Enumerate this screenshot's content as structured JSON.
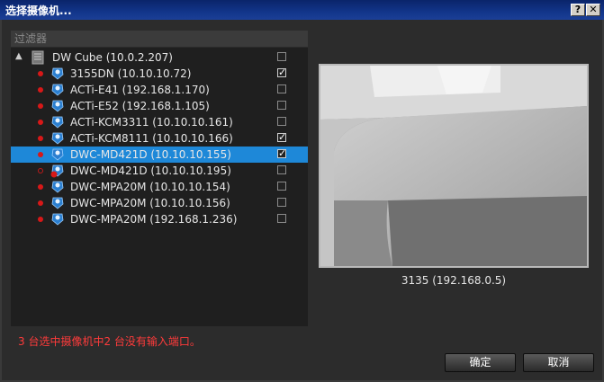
{
  "window": {
    "title": "选择摄像机...",
    "help_glyph": "?",
    "close_glyph": "✕"
  },
  "filter": {
    "placeholder": "过滤器"
  },
  "tree": {
    "server": {
      "label": "DW Cube (10.0.2.207)",
      "checked": false
    },
    "cameras": [
      {
        "label": "3155DN (10.10.10.72)",
        "checked": true,
        "selected": false,
        "status": "recording"
      },
      {
        "label": "ACTi-E41 (192.168.1.170)",
        "checked": false,
        "selected": false,
        "status": "recording"
      },
      {
        "label": "ACTi-E52 (192.168.1.105)",
        "checked": false,
        "selected": false,
        "status": "recording"
      },
      {
        "label": "ACTi-KCM3311 (10.10.10.161)",
        "checked": false,
        "selected": false,
        "status": "recording"
      },
      {
        "label": "ACTi-KCM8111 (10.10.10.166)",
        "checked": true,
        "selected": false,
        "status": "recording"
      },
      {
        "label": "DWC-MD421D (10.10.10.155)",
        "checked": true,
        "selected": true,
        "status": "recording"
      },
      {
        "label": "DWC-MD421D (10.10.10.195)",
        "checked": false,
        "selected": false,
        "status": "offline"
      },
      {
        "label": "DWC-MPA20M (10.10.10.154)",
        "checked": false,
        "selected": false,
        "status": "recording"
      },
      {
        "label": "DWC-MPA20M (10.10.10.156)",
        "checked": false,
        "selected": false,
        "status": "recording"
      },
      {
        "label": "DWC-MPA20M (192.168.1.236)",
        "checked": false,
        "selected": false,
        "status": "recording"
      }
    ]
  },
  "preview": {
    "caption": "3135 (192.168.0.5)"
  },
  "status_message": "3 台选中摄像机中2 台没有输入端口。",
  "buttons": {
    "ok": "确定",
    "cancel": "取消"
  },
  "colors": {
    "selection": "#1e88d8",
    "status_error": "#ff3b3b",
    "recording_dot": "#d81818"
  }
}
